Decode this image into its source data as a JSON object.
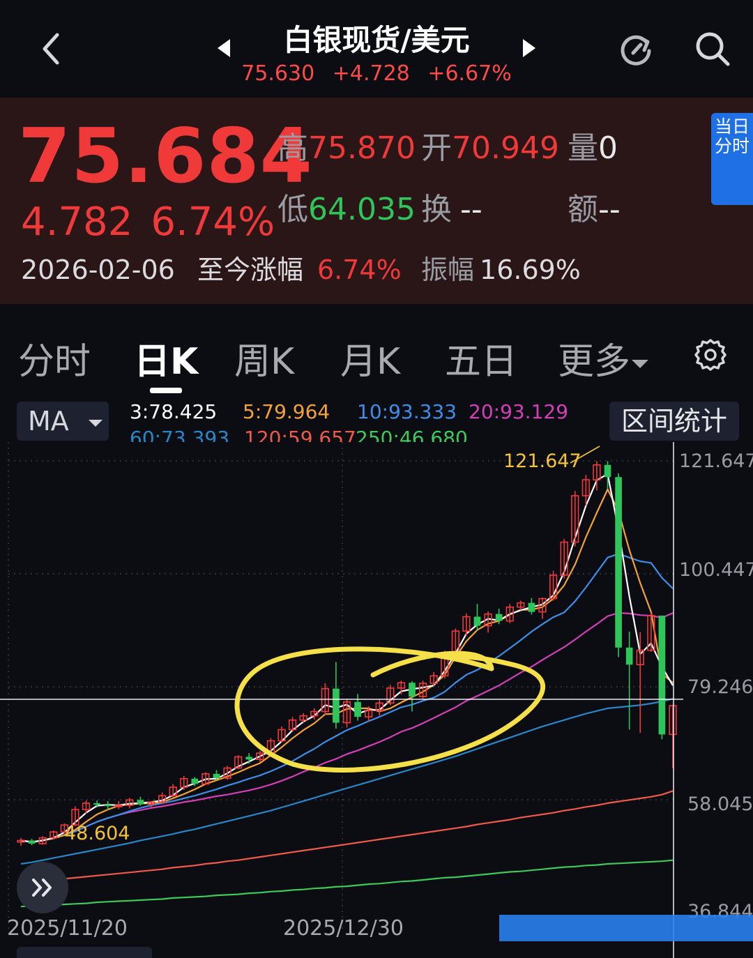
{
  "header": {
    "title": "白银现货/美元",
    "last_price": "75.630",
    "change": "+4.728",
    "change_pct": "+6.67%"
  },
  "quote": {
    "price": "75.684",
    "change": "4.782",
    "change_pct": "6.74%",
    "high_label": "高",
    "high": "75.870",
    "open_label": "开",
    "open": "70.949",
    "volume_label": "量",
    "volume": "0",
    "low_label": "低",
    "low": "64.035",
    "turnover_label": "换",
    "turnover": "--",
    "amount_label": "额",
    "amount": "--",
    "date": "2026-02-06",
    "ytd_label": "至今涨幅",
    "ytd": "6.74%",
    "amplitude_label": "振幅",
    "amplitude": "16.69%",
    "intraday_button": "当日分时"
  },
  "tabs": [
    "分时",
    "日K",
    "周K",
    "月K",
    "五日",
    "更多"
  ],
  "indicators": {
    "selector": "MA",
    "range_button": "区间统计",
    "ma3": "3:78.425",
    "ma5": "5:79.964",
    "ma10": "10:93.333",
    "ma20": "20:93.129",
    "ma60": "60:73.393",
    "ma120": "120:59.657",
    "ma250": "250:46.680"
  },
  "colors": {
    "up": "#f03a3a",
    "down": "#2fc55a",
    "ma3": "#ffffff",
    "ma5": "#f5a23a",
    "ma10": "#3e8ee8",
    "ma20": "#d43fb8",
    "ma60": "#2a86c8",
    "ma120": "#f05a4a",
    "ma250": "#3ec95a",
    "annotation": "#f5e04a",
    "accent": "#1f6fe5"
  },
  "chart_data": {
    "type": "candlestick",
    "y_ticks": [
      "121.647",
      "100.447",
      "79.246",
      "58.045",
      "36.844"
    ],
    "ylim": [
      36.844,
      121.647
    ],
    "x_ticks": [
      "2025/11/20",
      "2025/12/30"
    ],
    "max_label": "121.647",
    "min_label": "48.604",
    "crosshair_value": 76.9,
    "candles": [
      [
        50.1,
        50.9,
        49.4,
        50.4
      ],
      [
        50.4,
        50.7,
        49.5,
        49.8
      ],
      [
        49.8,
        51.2,
        49.6,
        50.9
      ],
      [
        50.9,
        52.3,
        50.6,
        52.0
      ],
      [
        52.0,
        53.6,
        51.7,
        53.3
      ],
      [
        53.3,
        56.8,
        53.1,
        56.2
      ],
      [
        56.2,
        57.9,
        55.4,
        57.4
      ],
      [
        57.4,
        57.9,
        56.6,
        57.1
      ],
      [
        57.1,
        57.8,
        56.1,
        56.9
      ],
      [
        56.9,
        57.8,
        56.3,
        57.0
      ],
      [
        57.0,
        58.4,
        56.4,
        58.0
      ],
      [
        58.0,
        58.6,
        56.9,
        57.2
      ],
      [
        57.2,
        57.8,
        56.6,
        57.6
      ],
      [
        57.6,
        59.4,
        57.2,
        58.8
      ],
      [
        58.8,
        61.0,
        58.4,
        60.4
      ],
      [
        60.4,
        62.5,
        59.9,
        62.0
      ],
      [
        62.0,
        62.3,
        60.6,
        61.0
      ],
      [
        61.0,
        63.2,
        60.8,
        62.9
      ],
      [
        62.9,
        63.6,
        61.8,
        62.1
      ],
      [
        62.1,
        64.4,
        61.8,
        64.0
      ],
      [
        64.0,
        66.4,
        63.8,
        66.1
      ],
      [
        66.1,
        66.8,
        64.8,
        65.6
      ],
      [
        65.6,
        67.2,
        65.0,
        66.8
      ],
      [
        66.8,
        69.6,
        66.5,
        69.1
      ],
      [
        69.1,
        71.8,
        68.8,
        71.2
      ],
      [
        71.2,
        73.6,
        70.8,
        73.0
      ],
      [
        73.0,
        74.3,
        72.4,
        73.8
      ],
      [
        73.8,
        75.2,
        73.1,
        74.6
      ],
      [
        74.6,
        79.9,
        74.0,
        78.9
      ],
      [
        78.9,
        83.9,
        71.4,
        72.5
      ],
      [
        72.5,
        77.0,
        71.6,
        76.4
      ],
      [
        76.4,
        77.9,
        72.9,
        73.6
      ],
      [
        73.6,
        75.6,
        72.7,
        74.8
      ],
      [
        74.8,
        76.8,
        73.8,
        76.2
      ],
      [
        76.2,
        79.6,
        75.8,
        79.0
      ],
      [
        79.0,
        80.4,
        77.8,
        80.0
      ],
      [
        80.0,
        80.3,
        74.6,
        77.4
      ],
      [
        77.4,
        80.4,
        77.0,
        79.9
      ],
      [
        79.9,
        82.0,
        79.4,
        81.3
      ],
      [
        81.3,
        86.0,
        80.8,
        85.5
      ],
      [
        85.5,
        90.2,
        84.8,
        89.7
      ],
      [
        89.7,
        93.0,
        88.8,
        92.4
      ],
      [
        92.4,
        94.8,
        89.8,
        90.7
      ],
      [
        90.7,
        93.4,
        89.4,
        92.9
      ],
      [
        92.9,
        93.9,
        91.0,
        91.6
      ],
      [
        91.6,
        94.8,
        91.2,
        94.2
      ],
      [
        94.2,
        95.4,
        93.6,
        95.0
      ],
      [
        95.0,
        95.9,
        92.8,
        93.3
      ],
      [
        93.3,
        96.0,
        92.0,
        95.8
      ],
      [
        95.8,
        101.0,
        95.4,
        100.2
      ],
      [
        100.2,
        107.0,
        99.6,
        106.4
      ],
      [
        106.4,
        116.0,
        105.6,
        115.1
      ],
      [
        115.1,
        119.0,
        113.3,
        118.1
      ],
      [
        118.1,
        121.6,
        116.1,
        120.9
      ],
      [
        120.9,
        121.6,
        116.4,
        118.6
      ],
      [
        118.6,
        119.3,
        84.8,
        86.6
      ],
      [
        86.6,
        89.6,
        71.2,
        83.4
      ],
      [
        83.4,
        89.5,
        70.6,
        86.1
      ],
      [
        86.1,
        93.1,
        85.8,
        92.6
      ],
      [
        92.6,
        92.6,
        69.4,
        70.3
      ],
      [
        70.3,
        75.9,
        64.0,
        75.7
      ]
    ],
    "ma_series": {
      "ma3": [
        50.4,
        50.1,
        50.4,
        50.9,
        51.9,
        53.8,
        55.6,
        56.9,
        57.1,
        57.0,
        57.3,
        57.4,
        57.6,
        57.9,
        58.9,
        60.4,
        61.1,
        61.9,
        62.0,
        63.0,
        64.3,
        65.2,
        66.2,
        67.2,
        69.0,
        71.1,
        72.7,
        73.8,
        75.8,
        75.3,
        75.9,
        74.2,
        74.9,
        74.9,
        76.7,
        78.4,
        78.8,
        79.1,
        79.5,
        82.2,
        85.5,
        89.2,
        90.9,
        92.0,
        91.7,
        92.9,
        93.6,
        94.2,
        94.7,
        96.4,
        100.8,
        107.2,
        113.2,
        118.0,
        119.2,
        108.7,
        96.2,
        85.4,
        87.4,
        83.0,
        79.5
      ],
      "ma5": [
        50.4,
        50.1,
        50.4,
        50.8,
        51.4,
        52.4,
        53.9,
        55.3,
        56.2,
        56.9,
        57.2,
        57.3,
        57.4,
        57.6,
        58.3,
        59.1,
        60.0,
        61.0,
        61.7,
        62.4,
        63.2,
        64.1,
        64.9,
        66.4,
        67.9,
        69.6,
        71.1,
        72.4,
        74.1,
        74.2,
        75.1,
        75.2,
        75.2,
        74.6,
        75.2,
        76.3,
        77.3,
        78.3,
        79.6,
        81.5,
        84.8,
        87.8,
        89.9,
        91.1,
        91.6,
        92.8,
        93.7,
        93.7,
        94.2,
        95.8,
        98.3,
        102.2,
        107.3,
        111.9,
        116.3,
        112.2,
        104.9,
        98.7,
        93.3,
        81.7,
        80.0
      ],
      "ma10": [
        50.4,
        50.1,
        50.4,
        50.8,
        51.4,
        52.1,
        53.0,
        53.9,
        54.6,
        55.2,
        55.9,
        56.5,
        57.0,
        57.4,
        57.8,
        58.3,
        58.8,
        59.4,
        60.0,
        60.7,
        61.3,
        62.0,
        62.6,
        63.4,
        64.3,
        65.3,
        66.5,
        67.6,
        68.9,
        70.0,
        71.1,
        71.9,
        72.8,
        73.6,
        74.5,
        75.4,
        75.9,
        76.6,
        77.2,
        78.3,
        80.0,
        81.5,
        82.4,
        83.7,
        85.0,
        86.5,
        88.0,
        89.6,
        91.0,
        92.3,
        93.2,
        95.3,
        97.9,
        100.7,
        103.5,
        104.2,
        103.5,
        102.8,
        102.5,
        99.7,
        97.7
      ],
      "ma20": [
        50.4,
        50.1,
        50.4,
        50.8,
        51.4,
        52.1,
        53.0,
        53.9,
        54.6,
        55.2,
        55.7,
        56.1,
        56.5,
        56.8,
        57.2,
        57.6,
        57.9,
        58.3,
        58.7,
        59.0,
        59.4,
        59.8,
        60.3,
        60.9,
        61.6,
        62.4,
        63.3,
        64.1,
        65.0,
        65.7,
        66.6,
        67.3,
        68.1,
        68.9,
        69.8,
        70.8,
        71.5,
        72.4,
        73.4,
        74.4,
        75.4,
        76.6,
        77.5,
        78.5,
        79.5,
        80.7,
        81.9,
        83.0,
        84.3,
        85.5,
        86.7,
        88.1,
        89.6,
        91.0,
        92.5,
        93.1,
        93.0,
        92.7,
        92.6,
        92.2,
        93.1
      ],
      "ma60": [
        46.0,
        46.3,
        46.7,
        47.1,
        47.5,
        47.9,
        48.3,
        48.7,
        49.1,
        49.5,
        49.9,
        50.4,
        50.8,
        51.2,
        51.6,
        52.1,
        52.5,
        53.0,
        53.5,
        54.0,
        54.5,
        55.0,
        55.5,
        56.0,
        56.6,
        57.2,
        57.8,
        58.4,
        59.0,
        59.6,
        60.2,
        60.8,
        61.4,
        62.0,
        62.6,
        63.2,
        63.8,
        64.4,
        65.0,
        65.6,
        66.2,
        66.9,
        67.6,
        68.3,
        69.0,
        69.7,
        70.4,
        71.1,
        71.8,
        72.4,
        73.0,
        73.6,
        74.2,
        74.7,
        75.2,
        75.4,
        75.6,
        75.8,
        76.1,
        76.5,
        77.0
      ],
      "ma120": [
        42.5,
        42.7,
        42.9,
        43.0,
        43.2,
        43.4,
        43.6,
        43.8,
        44.0,
        44.2,
        44.4,
        44.6,
        44.8,
        45.0,
        45.3,
        45.5,
        45.7,
        46.0,
        46.2,
        46.5,
        46.7,
        47.0,
        47.3,
        47.6,
        47.9,
        48.2,
        48.5,
        48.8,
        49.1,
        49.4,
        49.7,
        50.0,
        50.3,
        50.6,
        50.9,
        51.2,
        51.5,
        51.8,
        52.1,
        52.4,
        52.7,
        53.0,
        53.4,
        53.7,
        54.0,
        54.3,
        54.7,
        55.0,
        55.3,
        55.6,
        56.0,
        56.3,
        56.7,
        57.0,
        57.4,
        57.7,
        58.0,
        58.3,
        58.6,
        59.0,
        59.7
      ],
      "ma250": [
        38.0,
        38.1,
        38.2,
        38.3,
        38.4,
        38.5,
        38.6,
        38.8,
        38.9,
        39.0,
        39.1,
        39.2,
        39.3,
        39.4,
        39.6,
        39.7,
        39.8,
        39.9,
        40.1,
        40.2,
        40.3,
        40.5,
        40.6,
        40.8,
        40.9,
        41.1,
        41.2,
        41.4,
        41.5,
        41.7,
        41.8,
        42.0,
        42.2,
        42.3,
        42.5,
        42.7,
        42.8,
        43.0,
        43.2,
        43.4,
        43.5,
        43.7,
        43.9,
        44.1,
        44.3,
        44.5,
        44.6,
        44.8,
        45.0,
        45.2,
        45.4,
        45.5,
        45.7,
        45.8,
        46.0,
        46.1,
        46.2,
        46.3,
        46.4,
        46.5,
        46.7
      ]
    }
  }
}
